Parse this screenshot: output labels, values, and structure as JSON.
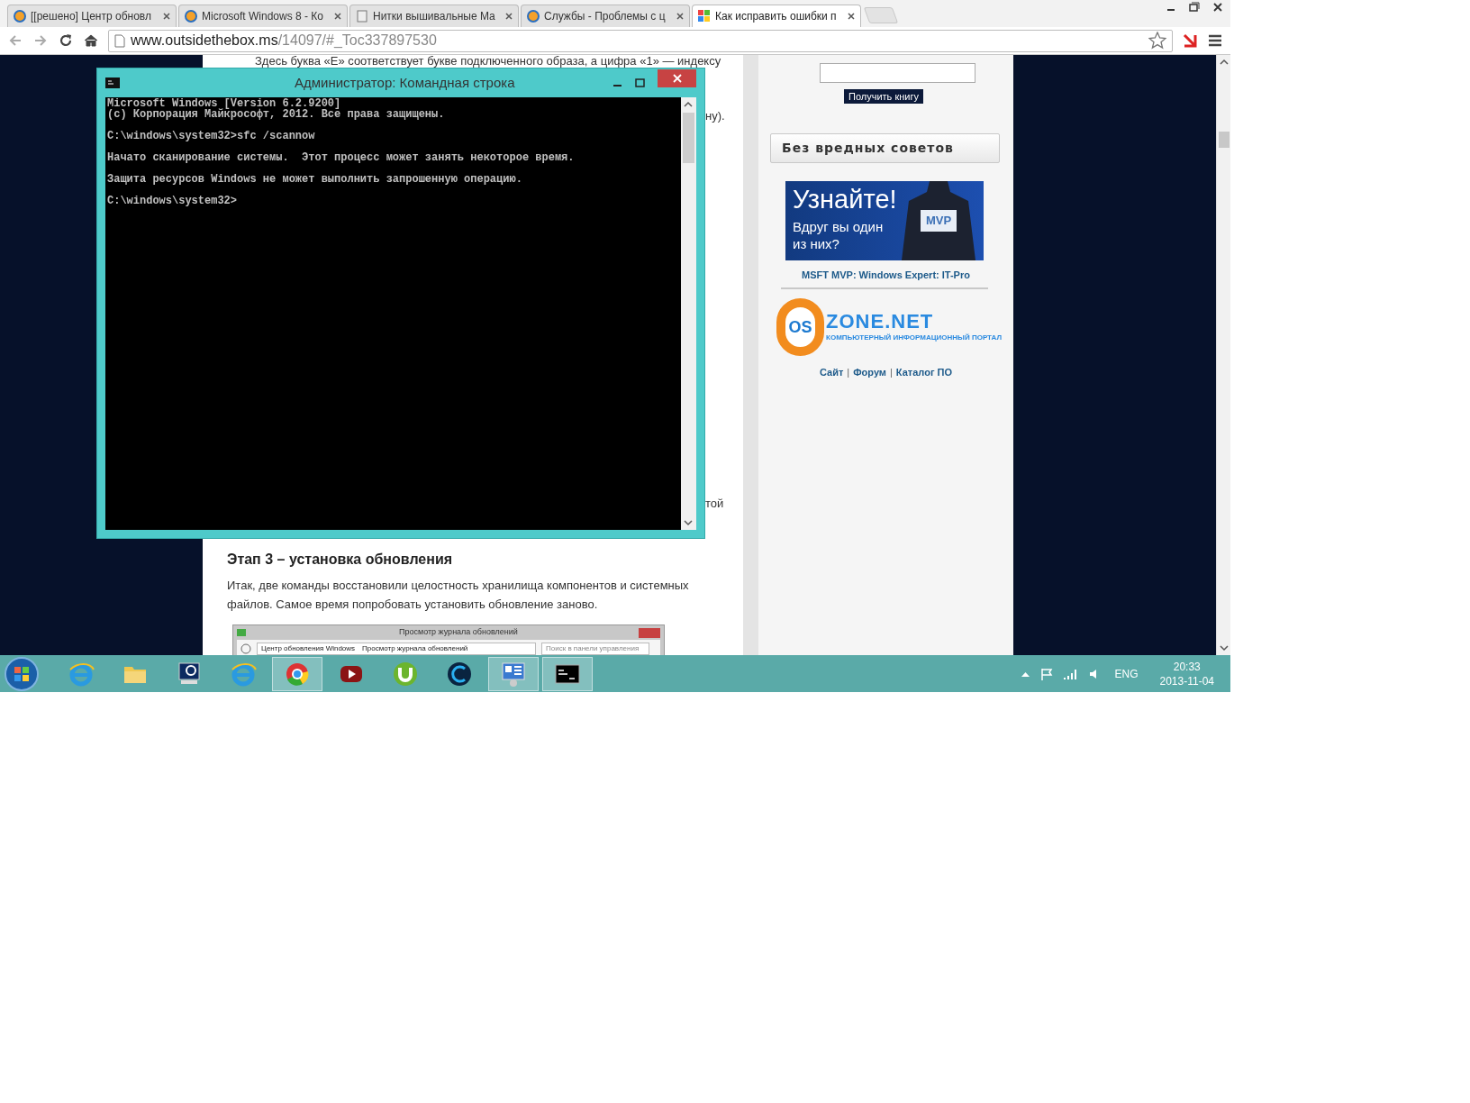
{
  "browser": {
    "tabs": [
      {
        "title": "[[решено] Центр обновл",
        "kind": "round",
        "selected": false
      },
      {
        "title": "Microsoft Windows 8 - Ко",
        "kind": "round",
        "selected": false
      },
      {
        "title": "Нитки вышивальные Ма",
        "kind": "page",
        "selected": false
      },
      {
        "title": "Службы - Проблемы с ц",
        "kind": "round",
        "selected": false
      },
      {
        "title": "Как исправить ошибки п",
        "kind": "windows",
        "selected": true
      }
    ],
    "url_host": "www.outsidethebox.ms",
    "url_path": "/14097/#_Toc337897530"
  },
  "article": {
    "top_line": "Здесь буква «E» соответствует букве подключенного образа, а цифра «1» — индексу",
    "fragment_1": "ну).",
    "fragment_2": "той",
    "heading": "Этап 3 – установка обновления",
    "paragraph": "Итак, две команды восстановили целостность хранилища компонентов и системных файлов. Самое время попробовать установить обновление заново.",
    "screenshot": {
      "title": "Просмотр журнала обновлений",
      "breadcrumb": [
        "Центр обновления Windows",
        "Просмотр журнала обновлений"
      ],
      "search_placeholder": "Поиск в панели управления"
    }
  },
  "sidebar": {
    "get_book_button": "Получить книгу",
    "section_title": "Без вредных советов",
    "banner": {
      "headline": "Узнайте!",
      "line_1": "Вдруг вы один",
      "line_2": "из них?",
      "badge": "MVP"
    },
    "banner_caption": "MSFT MVP: Windows Expert: IT-Pro",
    "logo": {
      "left": "OS",
      "right": "ZONE.NET",
      "tagline": "КОМПЬЮТЕРНЫЙ ИНФОРМАЦИОННЫЙ ПОРТАЛ"
    },
    "links": [
      "Сайт",
      "Форум",
      "Каталог ПО"
    ],
    "link_separator": "|"
  },
  "console_window": {
    "title": "Администратор: Командная строка",
    "blocks": [
      [
        "Microsoft Windows [Version 6.2.9200]",
        "(c) Корпорация Майкрософт, 2012. Все права защищены."
      ],
      [
        "C:\\windows\\system32>sfc /scannow"
      ],
      [
        "Начато сканирование системы.  Этот процесс может занять некоторое время."
      ],
      [
        "Защита ресурсов Windows не может выполнить запрошенную операцию."
      ],
      [
        "C:\\windows\\system32>"
      ]
    ]
  },
  "taskbar": {
    "items": [
      {
        "kind": "ie",
        "active": false
      },
      {
        "kind": "folder",
        "active": false
      },
      {
        "kind": "remote",
        "active": false
      },
      {
        "kind": "ie",
        "active": false
      },
      {
        "kind": "chrome",
        "active": true
      },
      {
        "kind": "player",
        "active": false
      },
      {
        "kind": "torrent",
        "active": false
      },
      {
        "kind": "c",
        "active": false
      },
      {
        "kind": "panel",
        "active": true
      },
      {
        "kind": "console",
        "active": true
      }
    ],
    "language": "ENG",
    "time": "20:33",
    "date": "2013-11-04"
  }
}
